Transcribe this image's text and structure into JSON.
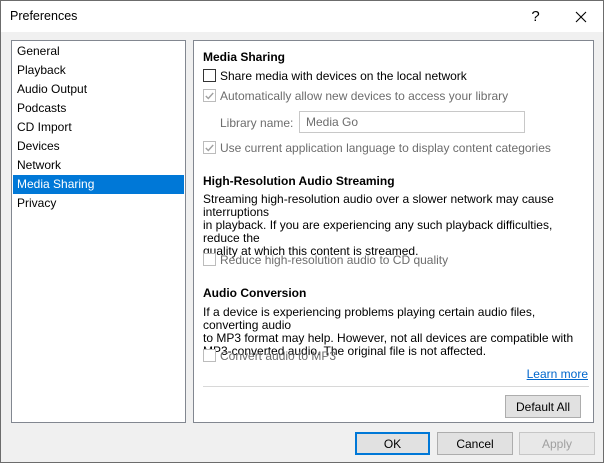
{
  "window": {
    "title": "Preferences",
    "help_glyph": "?"
  },
  "sidebar": {
    "items": [
      {
        "label": "General"
      },
      {
        "label": "Playback"
      },
      {
        "label": "Audio Output"
      },
      {
        "label": "Podcasts"
      },
      {
        "label": "CD Import"
      },
      {
        "label": "Devices"
      },
      {
        "label": "Network"
      },
      {
        "label": "Media Sharing",
        "selected": true
      },
      {
        "label": "Privacy"
      }
    ]
  },
  "media_sharing": {
    "title": "Media Sharing",
    "share_media_label": "Share media with devices on the local network",
    "share_media_checked": false,
    "auto_allow_label": "Automatically allow new devices to access your library",
    "auto_allow_checked": true,
    "library_name_label": "Library name:",
    "library_name_value": "Media Go",
    "use_language_label": "Use current application language to display content categories",
    "use_language_checked": true
  },
  "hires": {
    "title": "High-Resolution Audio Streaming",
    "description_line1": "Streaming high-resolution audio over a slower network may cause interruptions",
    "description_line2": "in playback. If you are experiencing any such playback difficulties, reduce the",
    "description_line3": "quality at which this content is streamed.",
    "reduce_label": "Reduce high-resolution audio to CD quality",
    "reduce_checked": false
  },
  "conversion": {
    "title": "Audio Conversion",
    "description_line1": "If a device is experiencing problems playing certain audio files, converting audio",
    "description_line2": "to MP3 format may help. However, not all devices are compatible with",
    "description_line3": "MP3-converted audio. The original file is not affected.",
    "convert_label": "Convert audio to MP3",
    "convert_checked": false
  },
  "panel": {
    "learn_more": "Learn more",
    "default_all": "Default All"
  },
  "footer": {
    "ok": "OK",
    "cancel": "Cancel",
    "apply": "Apply"
  },
  "colors": {
    "selection": "#0078d7",
    "link": "#0066cc",
    "disabled_text": "#6d6d6d"
  }
}
